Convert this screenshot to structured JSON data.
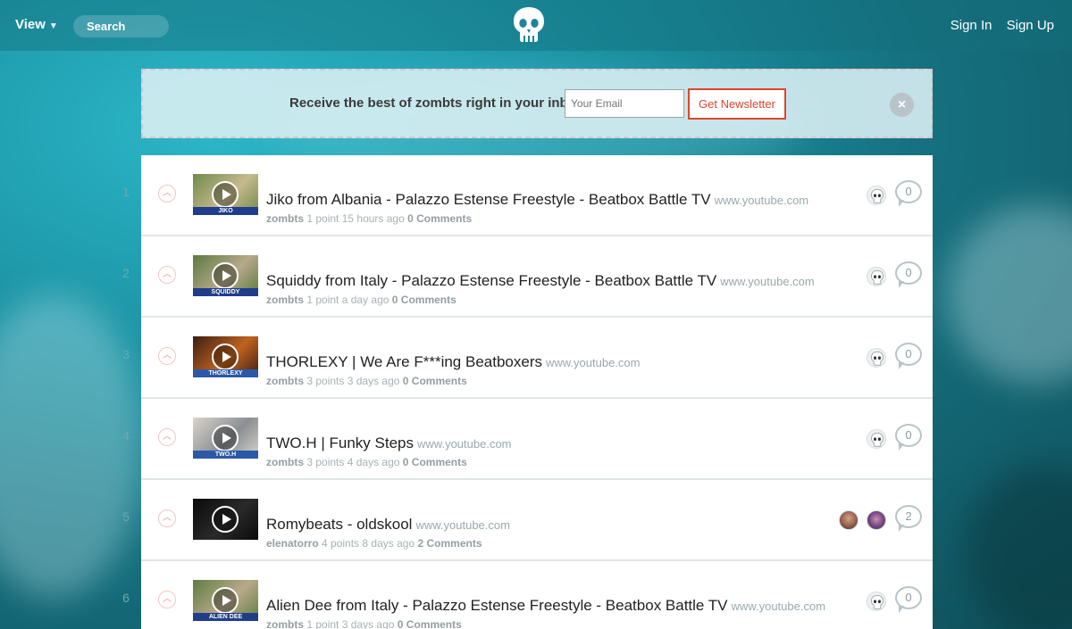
{
  "nav": {
    "view_label": "View",
    "search_placeholder": "Search",
    "sign_in": "Sign In",
    "sign_up": "Sign Up"
  },
  "newsletter": {
    "text": "Receive the best of zombts right in your inbox.",
    "email_placeholder": "Your Email",
    "button_label": "Get Newsletter",
    "close_icon": "×"
  },
  "posts": [
    {
      "rank": "1",
      "title": "Jiko from Albania - Palazzo Estense Freestyle - Beatbox Battle TV",
      "domain": "www.youtube.com",
      "author": "zombts",
      "points": "1 point",
      "age": "15 hours ago",
      "comments": "0 Comments",
      "comment_count": "0",
      "thumb_caption": "JIKO",
      "thumb_colors": [
        "#6f8a4a",
        "#c6b98e",
        "#1f3d8a"
      ]
    },
    {
      "rank": "2",
      "title": "Squiddy from Italy - Palazzo Estense Freestyle - Beatbox Battle TV",
      "domain": "www.youtube.com",
      "author": "zombts",
      "points": "1 point",
      "age": "a day ago",
      "comments": "0 Comments",
      "comment_count": "0",
      "thumb_caption": "SQUIDDY",
      "thumb_colors": [
        "#5c7a3f",
        "#b7a98a",
        "#1f3d8a"
      ]
    },
    {
      "rank": "3",
      "title": "THORLEXY | We Are F***ing Beatboxers",
      "domain": "www.youtube.com",
      "author": "zombts",
      "points": "3 points",
      "age": "3 days ago",
      "comments": "0 Comments",
      "comment_count": "0",
      "thumb_caption": "THORLEXY",
      "thumb_colors": [
        "#3a1f12",
        "#c0621f",
        "#2b58a8"
      ]
    },
    {
      "rank": "4",
      "title": "TWO.H | Funky Steps",
      "domain": "www.youtube.com",
      "author": "zombts",
      "points": "3 points",
      "age": "4 days ago",
      "comments": "0 Comments",
      "comment_count": "0",
      "thumb_caption": "TWO.H",
      "thumb_colors": [
        "#d9d4cc",
        "#8a8f92",
        "#2b58a8"
      ]
    },
    {
      "rank": "5",
      "title": "Romybeats - oldskool",
      "domain": "www.youtube.com",
      "author": "elenatorro",
      "points": "4 points",
      "age": "8 days ago",
      "comments": "2 Comments",
      "comment_count": "2",
      "thumb_caption": "",
      "thumb_colors": [
        "#0a0a0a",
        "#2a2a2a",
        "#0a0a0a"
      ]
    },
    {
      "rank": "6",
      "title": "Alien Dee from Italy - Palazzo Estense Freestyle - Beatbox Battle TV",
      "domain": "www.youtube.com",
      "author": "zombts",
      "points": "1 point",
      "age": "3 days ago",
      "comments": "0 Comments",
      "comment_count": "0",
      "thumb_caption": "ALIEN DEE",
      "thumb_colors": [
        "#5e7d40",
        "#b9a98b",
        "#1f3d8a"
      ]
    }
  ]
}
